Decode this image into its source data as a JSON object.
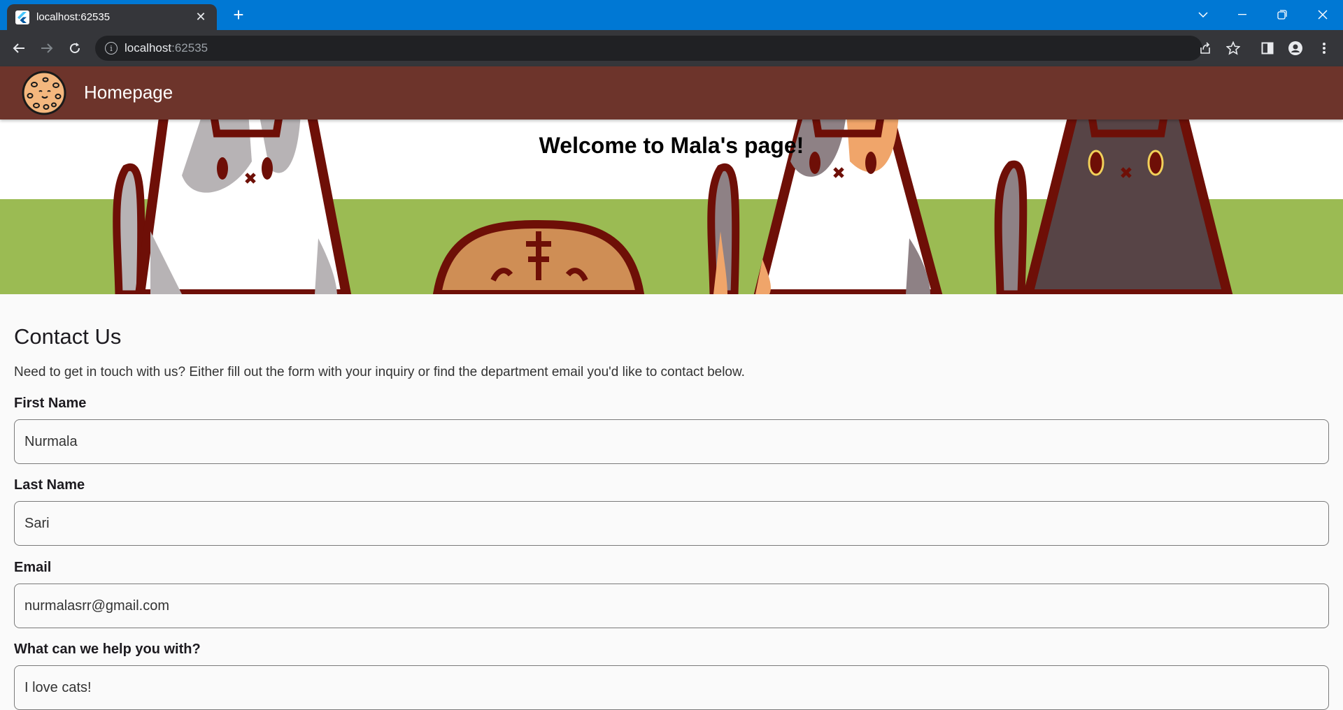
{
  "browser": {
    "tab_title": "localhost:62535",
    "url_host": "localhost",
    "url_port": ":62535"
  },
  "appbar": {
    "title": "Homepage",
    "color": "#6d342b"
  },
  "banner": {
    "title": "Welcome to Mala's page!"
  },
  "contact": {
    "title": "Contact Us",
    "intro": "Need to get in touch with us? Either fill out the form with your inquiry or find the department email you'd like to contact below.",
    "fields": [
      {
        "label": "First Name",
        "value": "Nurmala"
      },
      {
        "label": "Last Name",
        "value": "Sari"
      },
      {
        "label": "Email",
        "value": "nurmalasrr@gmail.com"
      },
      {
        "label": "What can we help you with?",
        "value": "I love cats!"
      }
    ]
  },
  "icons": {
    "tab_favicon": "flutter-icon",
    "logo": "cookie-icon"
  }
}
